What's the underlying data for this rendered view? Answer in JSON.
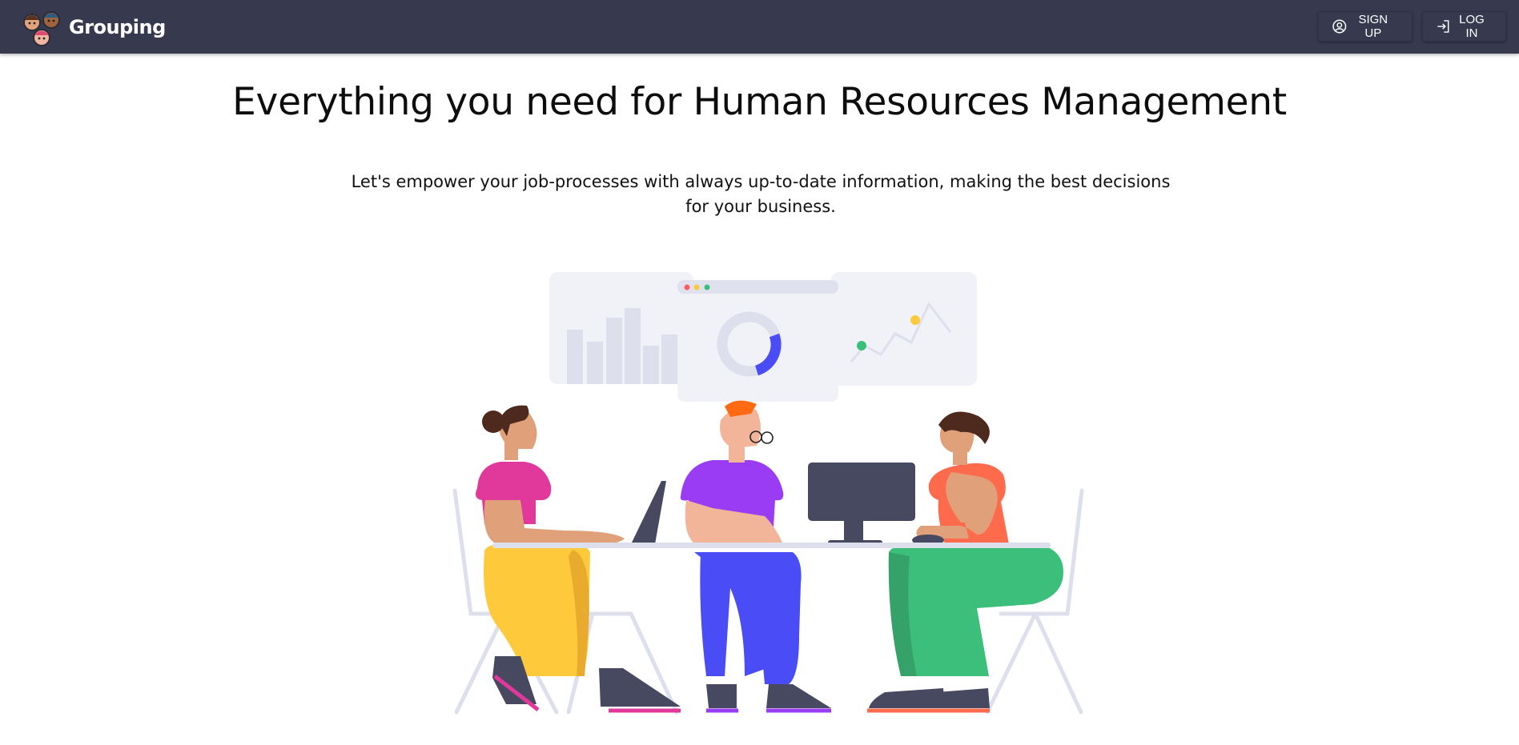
{
  "header": {
    "brand": "Grouping",
    "signup_label": "SIGN UP",
    "login_label": "LOG IN"
  },
  "hero": {
    "title": "Everything you need for Human Resources Management",
    "subtitle": "Let's empower your job-processes with always up-to-date information, making the best decisions for your business."
  },
  "colors": {
    "topbar": "#373a4f",
    "accent_blue": "#4a4cf5",
    "yellow": "#fec93a",
    "green": "#3cbf7a",
    "magenta": "#e1389b",
    "purple": "#9b3cf5",
    "coral": "#fe6a4c"
  }
}
